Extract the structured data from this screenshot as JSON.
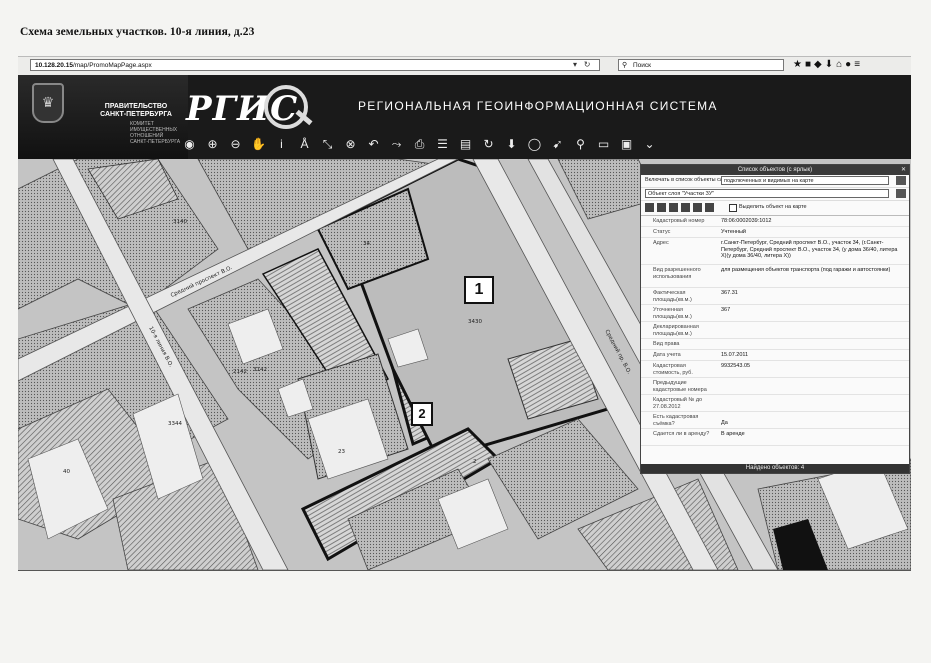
{
  "doc_title": "Схема земельных участков. 10-я линия, д.23",
  "browser": {
    "url_host": "10.128.20.15",
    "url_path": "/map/PromoMapPage.aspx",
    "search_placeholder": "Поиск"
  },
  "header": {
    "admin_line1": "ПРАВИТЕЛЬСТВО",
    "admin_line2": "САНКТ-ПЕТЕРБУРГА",
    "committee": "КОМИТЕТ ИМУЩЕСТВЕННЫХ ОТНОШЕНИЙ САНКТ-ПЕТЕРБУРГА",
    "logo": "РГИС",
    "system_name": "РЕГИОНАЛЬНАЯ ГЕОИНФОРМАЦИОННАЯ СИСТЕМА"
  },
  "map": {
    "streets": [
      "Средний проспект В.О.",
      "10-я линия В.О.",
      "Средний пр. В.О."
    ],
    "parcel_labels": [
      "1",
      "2"
    ],
    "map_labels": [
      "3140",
      "3142",
      "2142",
      "3344",
      "34",
      "3430",
      "40",
      "2",
      "23"
    ]
  },
  "panel": {
    "title": "Список объектов (с ярлык)",
    "include_label": "Включать в список объекты слоев:",
    "include_value": "подключенных и видимых на карте",
    "type_value": "Объект слоя \"Участки ЗУ\"",
    "show_on_map": "Выделить объект на карте",
    "rows": [
      {
        "k": "Кадастровый номер",
        "v": "78:06:0002039:1012"
      },
      {
        "k": "Статус",
        "v": "Учтенный"
      },
      {
        "k": "Адрес",
        "v": "г.Санкт-Петербург, Средний проспект В.О., участок 34, (г.Санкт-Петербург, Средний проспект В.О., участок 34, (у дома 36/40, литера Х)(у дома 36/40, литера Х))"
      },
      {
        "k": "Вид разрешенного использования",
        "v": "для размещения объектов транспорта (под гаражи и автостоянки)"
      },
      {
        "k": "Фактическая площадь(кв.м.)",
        "v": "367.31"
      },
      {
        "k": "Уточненная площадь(кв.м.)",
        "v": "367"
      },
      {
        "k": "Декларированная площадь(кв.м.)",
        "v": ""
      },
      {
        "k": "Вид права",
        "v": ""
      },
      {
        "k": "Дата учета",
        "v": "15.07.2011"
      },
      {
        "k": "Кадастровая стоимость, руб.",
        "v": "9932543.05"
      },
      {
        "k": "Предыдущие кадастровые номера",
        "v": ""
      },
      {
        "k": "Кадастровый № до 27.08.2012",
        "v": ""
      },
      {
        "k": "Есть кадастровая съёмка?",
        "v": "Да"
      },
      {
        "k": "Сдается ли в аренду?",
        "v": "В аренде"
      }
    ],
    "footer": "Найдено объектов: 4"
  }
}
